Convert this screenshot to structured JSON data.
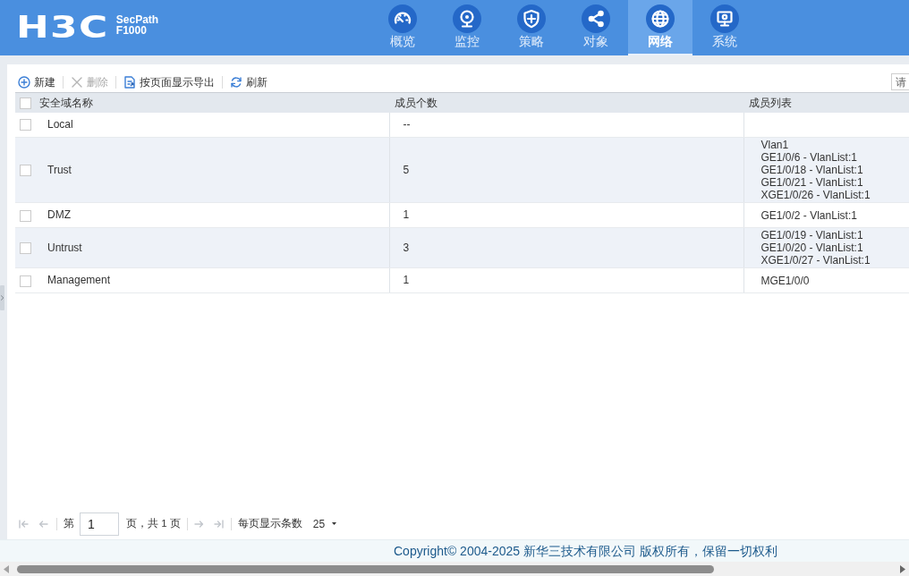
{
  "header": {
    "logo": "H3C",
    "product": "SecPath",
    "model": "F1000"
  },
  "nav_tabs": [
    {
      "label": "概览",
      "selected": false
    },
    {
      "label": "监控",
      "selected": false
    },
    {
      "label": "策略",
      "selected": false
    },
    {
      "label": "对象",
      "selected": false
    },
    {
      "label": "网络",
      "selected": true
    },
    {
      "label": "系统",
      "selected": false
    }
  ],
  "toolbar": [
    {
      "label": "新建",
      "disabled": false
    },
    {
      "label": "删除",
      "disabled": true
    },
    {
      "label": "按页面显示导出",
      "disabled": false
    },
    {
      "label": "刷新",
      "disabled": false
    }
  ],
  "search": {
    "placeholder": "请"
  },
  "table": {
    "select_all_checked": false,
    "columns": [
      "安全域名称",
      "成员个数",
      "成员列表"
    ],
    "rows": [
      {
        "checked": false,
        "name": "Local",
        "member_count": "--"
      },
      {
        "checked": false,
        "name": "Trust",
        "member_count": "5",
        "members": [
          "Vlan1",
          "GE1/0/6 - VlanList:1",
          "GE1/0/18 - VlanList:1",
          "GE1/0/21 - VlanList:1",
          "XGE1/0/26 - VlanList:1"
        ]
      },
      {
        "checked": false,
        "name": "DMZ",
        "member_count": "1",
        "members": [
          "GE1/0/2 - VlanList:1"
        ]
      },
      {
        "checked": false,
        "name": "Untrust",
        "member_count": "3",
        "members": [
          "GE1/0/19 - VlanList:1",
          "GE1/0/20 - VlanList:1",
          "XGE1/0/27 - VlanList:1"
        ]
      },
      {
        "checked": false,
        "name": "Management",
        "member_count": "1",
        "members": [
          "MGE1/0/0"
        ]
      }
    ]
  },
  "pagination": {
    "back_buttons": [
      {
        "kind": "first",
        "disabled": true
      },
      {
        "kind": "previous",
        "disabled": true
      }
    ],
    "page_prefix": "第",
    "page": "1",
    "page_suffix": "页，共 1 页",
    "forward_buttons": [
      {
        "kind": "next",
        "disabled": true
      },
      {
        "kind": "last",
        "disabled": true
      }
    ],
    "page_size_label": "每页显示条数",
    "page_size": "25"
  },
  "footer": {
    "copyright": "Copyright© 2004-2025 新华三技术有限公司 版权所有，保留一切权利"
  }
}
